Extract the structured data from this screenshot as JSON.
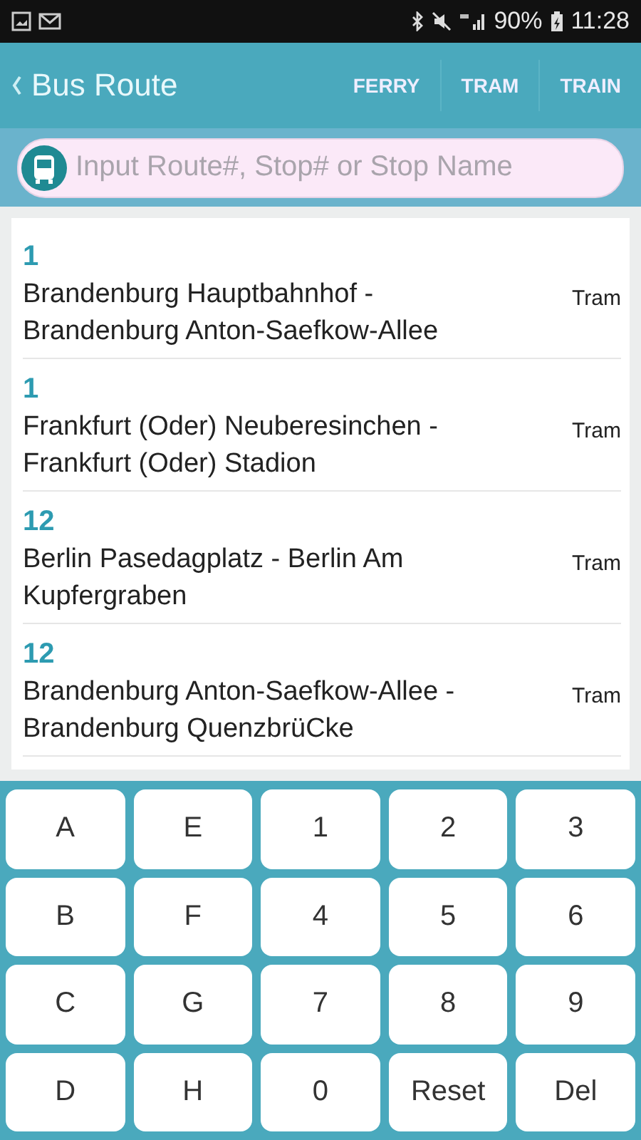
{
  "status_bar": {
    "battery": "90%",
    "time": "11:28"
  },
  "header": {
    "title": "Bus Route",
    "tabs": [
      "FERRY",
      "TRAM",
      "TRAIN"
    ]
  },
  "search": {
    "placeholder": "Input Route#, Stop# or Stop Name"
  },
  "routes": [
    {
      "number": "1",
      "name": "Brandenburg Hauptbahnhof - Brandenburg Anton-Saefkow-Allee",
      "mode": "Tram"
    },
    {
      "number": "1",
      "name": "Frankfurt (Oder) Neuberesinchen - Frankfurt (Oder) Stadion",
      "mode": "Tram"
    },
    {
      "number": "12",
      "name": "Berlin Pasedagplatz - Berlin Am Kupfergraben",
      "mode": "Tram"
    },
    {
      "number": "12",
      "name": "Brandenburg Anton-Saefkow-Allee - Brandenburg QuenzbrüCke",
      "mode": "Tram"
    }
  ],
  "keypad": [
    "A",
    "E",
    "1",
    "2",
    "3",
    "B",
    "F",
    "4",
    "5",
    "6",
    "C",
    "G",
    "7",
    "8",
    "9",
    "D",
    "H",
    "0",
    "Reset",
    "Del"
  ]
}
